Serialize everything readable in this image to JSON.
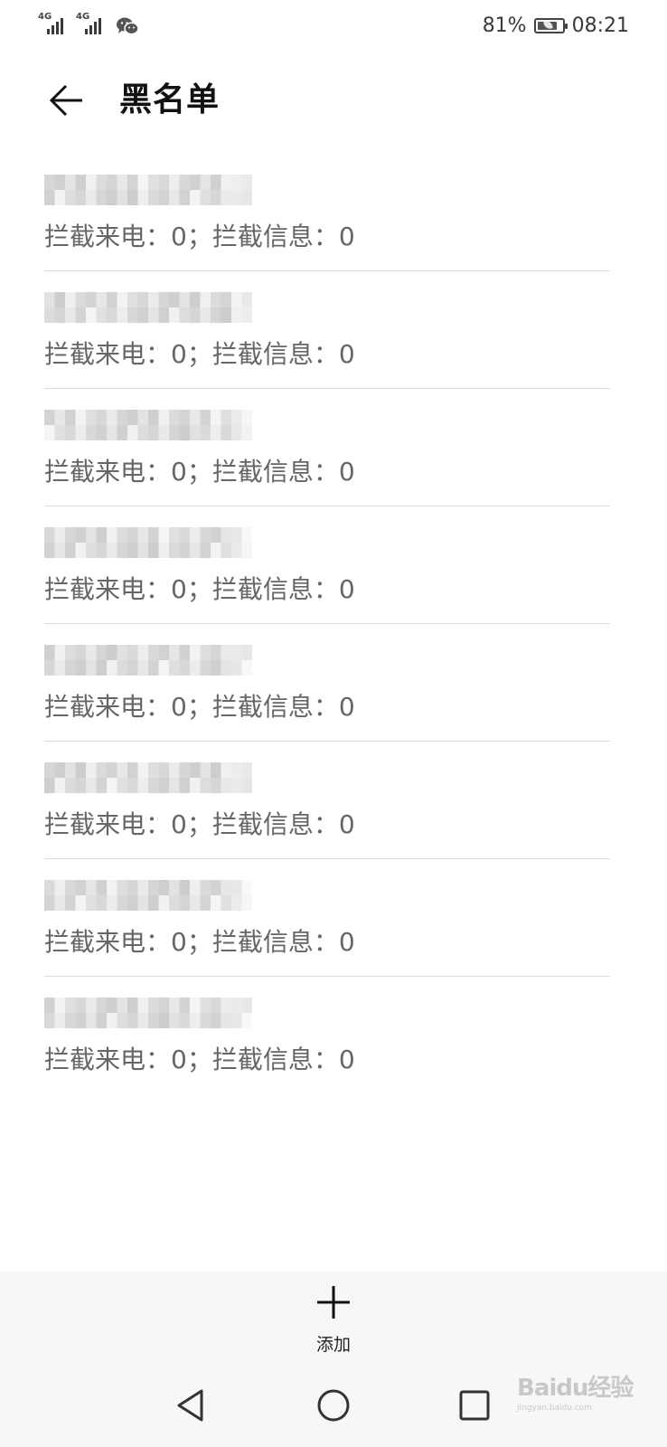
{
  "status_bar": {
    "network_1": "4G",
    "network_2": "4G",
    "app_icon": "wechat-icon",
    "battery_percent": "81%",
    "battery_level": 0.81,
    "time": "08:21"
  },
  "header": {
    "back_icon": "arrow-left-icon",
    "title": "黑名单"
  },
  "blocklist": {
    "items": [
      {
        "partial": "",
        "stats": "拦截来电：0；拦截信息：0"
      },
      {
        "partial": "...015",
        "stats": "拦截来电：0；拦截信息：0"
      },
      {
        "partial": "...1149",
        "stats": "拦截来电：0；拦截信息：0"
      },
      {
        "partial": "0...01",
        "stats": "拦截来电：0；拦截信息：0"
      },
      {
        "partial": "07...",
        "stats": "拦截来电：0；拦截信息：0"
      },
      {
        "partial": "2...",
        "stats": "拦截来电：0；拦截信息：0"
      },
      {
        "partial": "...1440",
        "stats": "拦截来电：0；拦截信息：0"
      },
      {
        "partial": "077...",
        "stats": "拦截来电：0；拦截信息：0"
      }
    ]
  },
  "add_bar": {
    "icon": "plus-icon",
    "label": "添加"
  },
  "nav_bar": {
    "back_icon": "triangle-back-icon",
    "home_icon": "circle-home-icon",
    "recents_icon": "square-recents-icon"
  },
  "watermark": {
    "text": "Baidu经验",
    "sub": "jingyan.baidu.com"
  }
}
